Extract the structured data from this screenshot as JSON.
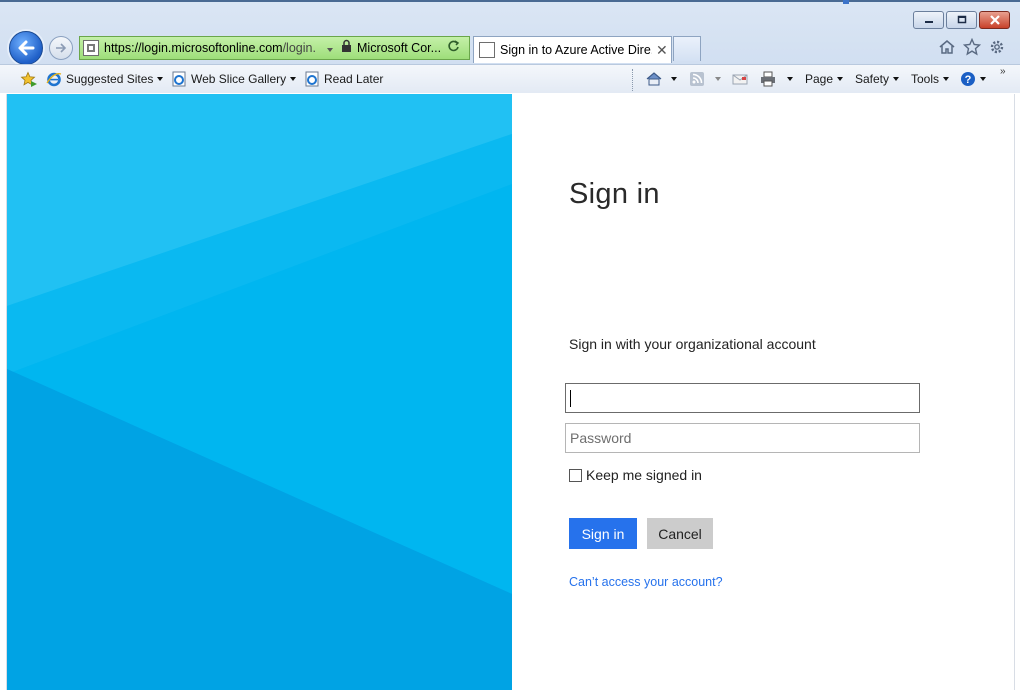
{
  "browser": {
    "address": {
      "url_main": "https://login.microsoftonline.com",
      "url_rest": "/login.",
      "identity": "Microsoft Cor..."
    },
    "tab": {
      "title": "Sign in to Azure Active Dire...",
      "close_glyph": "✕"
    },
    "favorites_bar": {
      "suggested_sites": "Suggested Sites",
      "web_slice_gallery": "Web Slice Gallery",
      "read_later": "Read Later"
    },
    "command_bar": {
      "page": "Page",
      "safety": "Safety",
      "tools": "Tools",
      "overflow": "»"
    },
    "icons": [
      "back-arrow-icon",
      "forward-arrow-icon",
      "lock-icon",
      "refresh-icon",
      "home-icon",
      "star-icon",
      "gear-icon",
      "rss-icon",
      "mail-icon",
      "print-icon",
      "help-icon",
      "favorites-star-icon",
      "ie-icon"
    ]
  },
  "page": {
    "title": "Sign in",
    "subtitle": "Sign in with your organizational account",
    "username": {
      "value": "",
      "placeholder": ""
    },
    "password": {
      "value": "",
      "placeholder": "Password"
    },
    "keep_signed_in": {
      "label": "Keep me signed in",
      "checked": false
    },
    "signin_button": "Sign in",
    "cancel_button": "Cancel",
    "cant_access_link": "Can’t access your account?"
  },
  "colors": {
    "accent": "#2672ec",
    "hero_light": "#21c1f3",
    "hero_mid": "#00b3ef",
    "hero_dark": "#00a4e4",
    "address_secure": "#a8e487"
  }
}
